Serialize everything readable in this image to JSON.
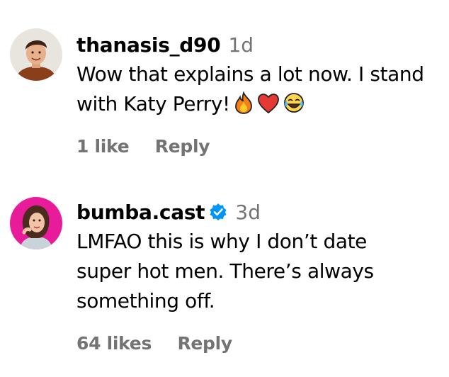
{
  "comments": [
    {
      "username": "thanasis_d90",
      "time": "1d",
      "verified": false,
      "text_lines": [
        "Wow that explains a lot now. I stand",
        "with Katy Perry!"
      ],
      "emojis": [
        "fire-emoji",
        "heart-emoji",
        "joy-emoji"
      ],
      "likes": "1 like",
      "reply": "Reply"
    },
    {
      "username": "bumba.cast",
      "time": "3d",
      "verified": true,
      "text_lines": [
        "LMFAO this is why I don’t date",
        "super hot men. There’s always",
        "something off."
      ],
      "likes": "64 likes",
      "reply": "Reply"
    }
  ],
  "colors": {
    "secondary_text": "#737373",
    "verified_badge": "#0095f6",
    "avatar2_ring": "#e81b9a"
  }
}
